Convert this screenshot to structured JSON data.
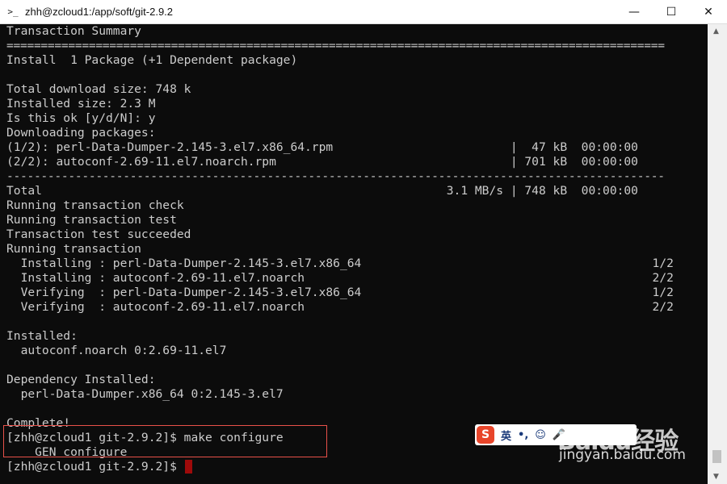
{
  "window": {
    "title": "zhh@zcloud1:/app/soft/git-2.9.2",
    "icon": "terminal-icon",
    "controls": {
      "minimize": "—",
      "maximize": "☐",
      "close": "✕"
    }
  },
  "terminal": {
    "lines": [
      "Transaction Summary",
      "================================================================================================",
      "Install  1 Package (+1 Dependent package)",
      "",
      "Total download size: 748 k",
      "Installed size: 2.3 M",
      "Is this ok [y/d/N]: y",
      "Downloading packages:",
      "(1/2): perl-Data-Dumper-2.145-3.el7.x86_64.rpm                         |  47 kB  00:00:00",
      "(2/2): autoconf-2.69-11.el7.noarch.rpm                                 | 701 kB  00:00:00",
      "------------------------------------------------------------------------------------------------",
      "Total                                                         3.1 MB/s | 748 kB  00:00:00",
      "Running transaction check",
      "Running transaction test",
      "Transaction test succeeded",
      "Running transaction",
      "  Installing : perl-Data-Dumper-2.145-3.el7.x86_64                                         1/2",
      "  Installing : autoconf-2.69-11.el7.noarch                                                 2/2",
      "  Verifying  : perl-Data-Dumper-2.145-3.el7.x86_64                                         1/2",
      "  Verifying  : autoconf-2.69-11.el7.noarch                                                 2/2",
      "",
      "Installed:",
      "  autoconf.noarch 0:2.69-11.el7",
      "",
      "Dependency Installed:",
      "  perl-Data-Dumper.x86_64 0:2.145-3.el7",
      "",
      "Complete!",
      "[zhh@zcloud1 git-2.9.2]$ make configure",
      "    GEN configure",
      "[zhh@zcloud1 git-2.9.2]$ "
    ]
  },
  "ime": {
    "logo": "S",
    "lang": "英",
    "punct": "•,",
    "emoji": "☺",
    "mic": "🎤"
  },
  "watermark": {
    "logo": "Baidu经验",
    "url": "jingyan.baidu.com"
  },
  "colors": {
    "background": "#0c0c0c",
    "text": "#cccccc",
    "cursor": "#9e0a0a",
    "highlight": "#e8514a"
  }
}
